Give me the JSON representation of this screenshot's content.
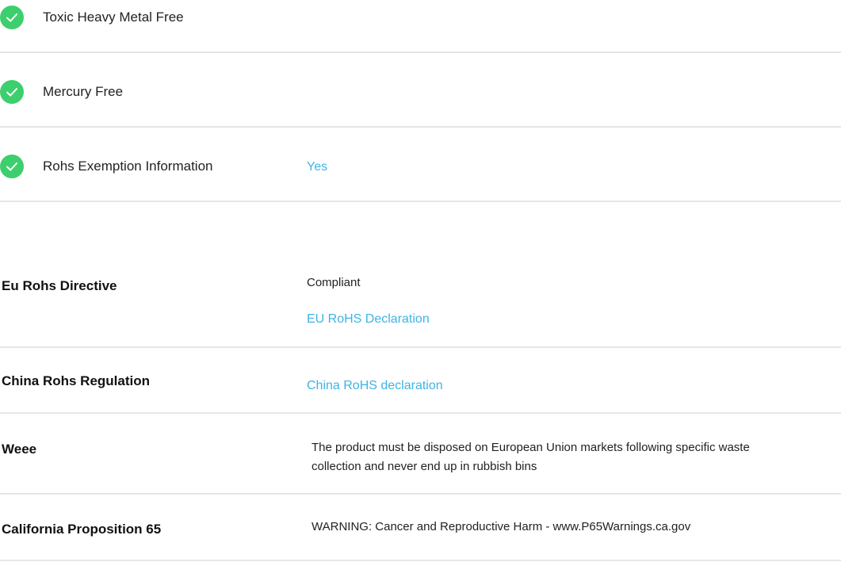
{
  "checks": [
    {
      "label": "Toxic Heavy Metal Free",
      "value": ""
    },
    {
      "label": "Mercury Free",
      "value": ""
    },
    {
      "label": "Rohs Exemption Information",
      "value": "Yes"
    }
  ],
  "specs": {
    "eu_rohs": {
      "label": "Eu Rohs Directive",
      "status": "Compliant",
      "link": "EU RoHS Declaration"
    },
    "china_rohs": {
      "label": "China Rohs Regulation",
      "link": "China RoHS declaration"
    },
    "weee": {
      "label": "Weee",
      "text_line1": "The product must be disposed on European Union markets following specific waste",
      "text_line2": "collection and never end up in rubbish bins"
    },
    "prop65": {
      "label": "California Proposition 65",
      "text": "WARNING: Cancer and Reproductive Harm - www.P65Warnings.ca.gov"
    }
  },
  "colors": {
    "check": "#3dcf6d",
    "link": "#3db4e5",
    "divider": "#e6e6e6"
  },
  "icons": {
    "check": "checkmark-circle-icon"
  }
}
